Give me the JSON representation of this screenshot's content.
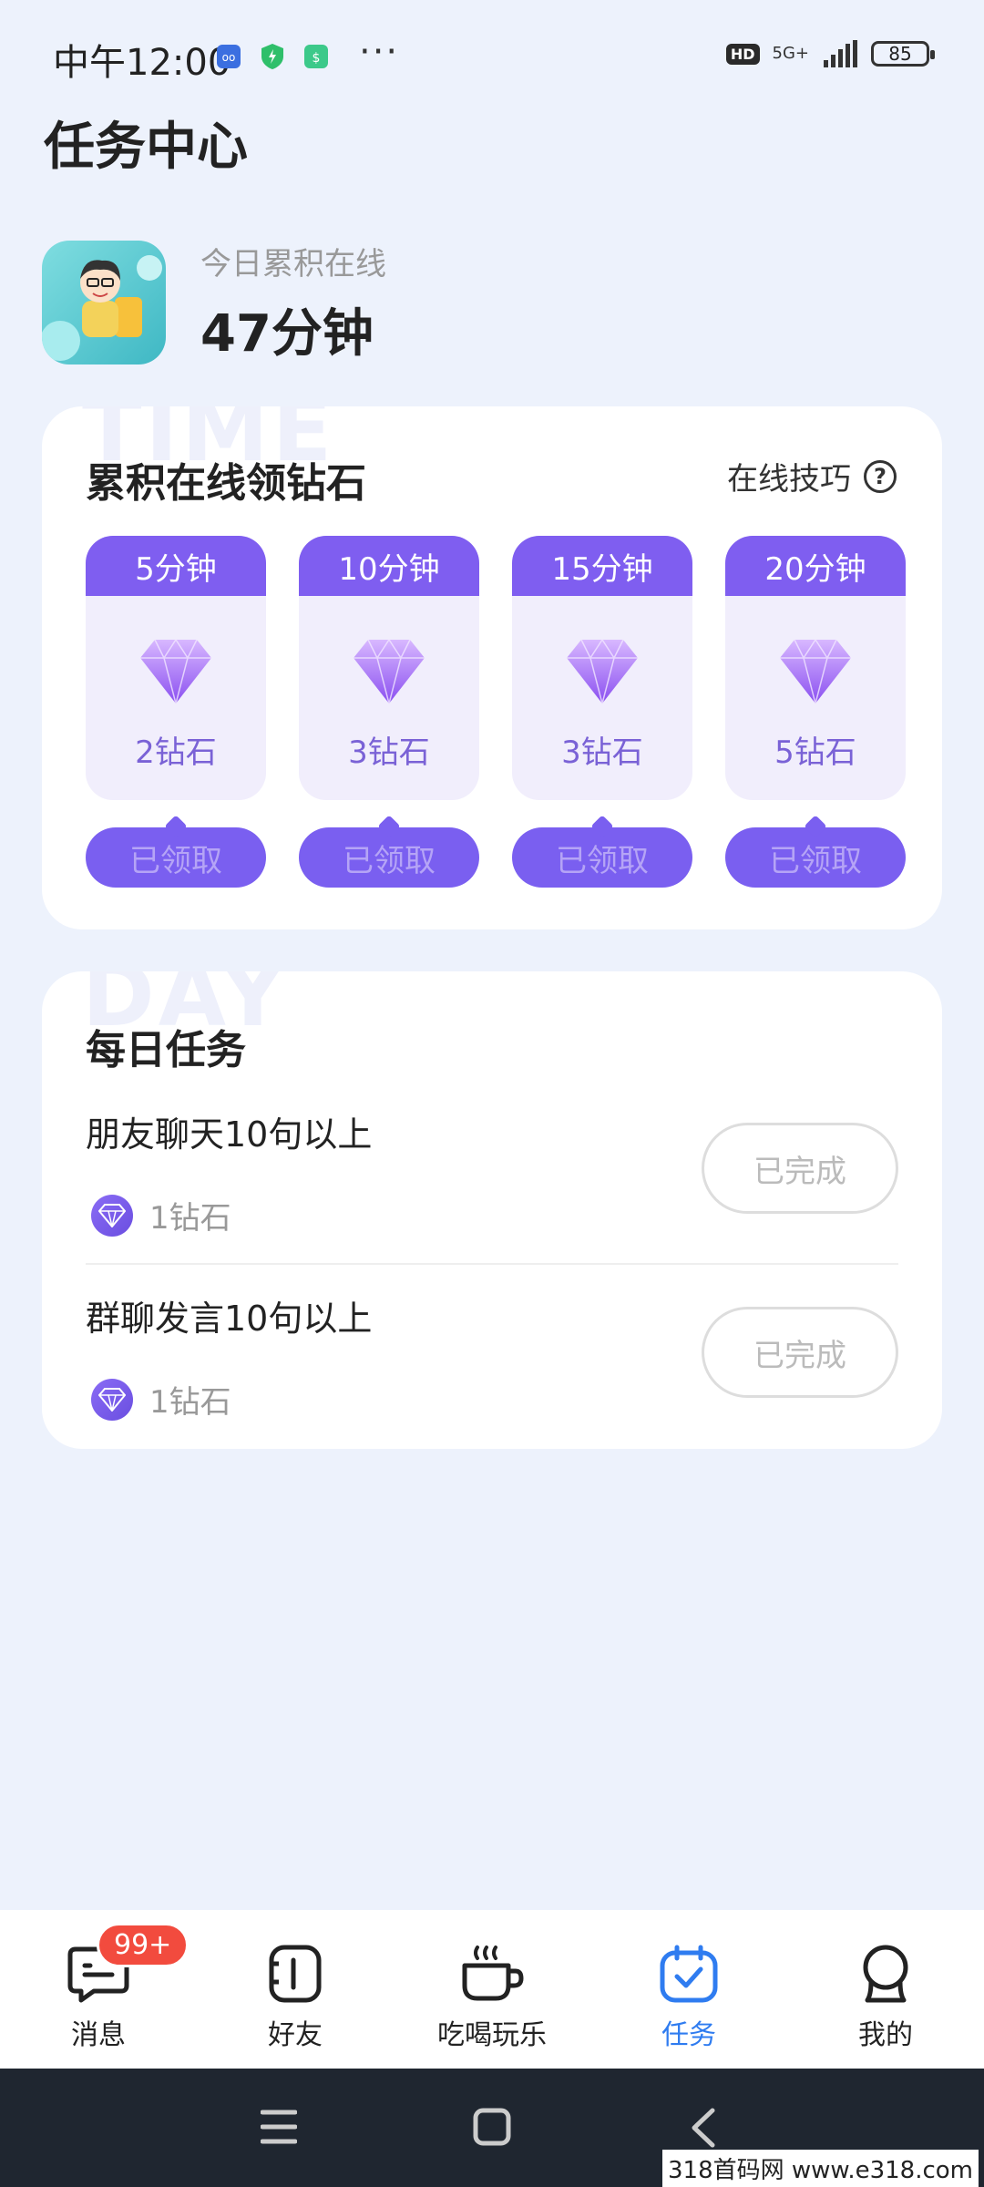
{
  "status_bar": {
    "time": "中午12:00",
    "more": "···",
    "hd": "HD",
    "network": "5G+",
    "battery": "85"
  },
  "page": {
    "title": "任务中心"
  },
  "summary": {
    "label": "今日累积在线",
    "value": "47分钟"
  },
  "online_card": {
    "watermark": "TIME",
    "title": "累积在线领钻石",
    "tips_label": "在线技巧",
    "tips_icon": "?",
    "tiles": [
      {
        "duration": "5分钟",
        "reward": "2钻石",
        "button": "已领取"
      },
      {
        "duration": "10分钟",
        "reward": "3钻石",
        "button": "已领取"
      },
      {
        "duration": "15分钟",
        "reward": "3钻石",
        "button": "已领取"
      },
      {
        "duration": "20分钟",
        "reward": "5钻石",
        "button": "已领取"
      }
    ]
  },
  "daily_card": {
    "watermark": "DAY",
    "title": "每日任务",
    "tasks": [
      {
        "title": "朋友聊天10句以上",
        "reward": "1钻石",
        "button": "已完成"
      },
      {
        "title": "群聊发言10句以上",
        "reward": "1钻石",
        "button": "已完成"
      }
    ]
  },
  "bottom_nav": {
    "items": [
      {
        "label": "消息",
        "icon": "message-icon",
        "badge": "99+"
      },
      {
        "label": "好友",
        "icon": "contacts-icon"
      },
      {
        "label": "吃喝玩乐",
        "icon": "coffee-icon"
      },
      {
        "label": "任务",
        "icon": "task-icon",
        "active": true
      },
      {
        "label": "我的",
        "icon": "profile-icon"
      }
    ],
    "active_color": "#2f7cf0"
  },
  "footer": {
    "watermark": "318首码网 www.e318.com"
  },
  "colors": {
    "accent": "#7f5ef0",
    "background": "#edf2fc"
  }
}
